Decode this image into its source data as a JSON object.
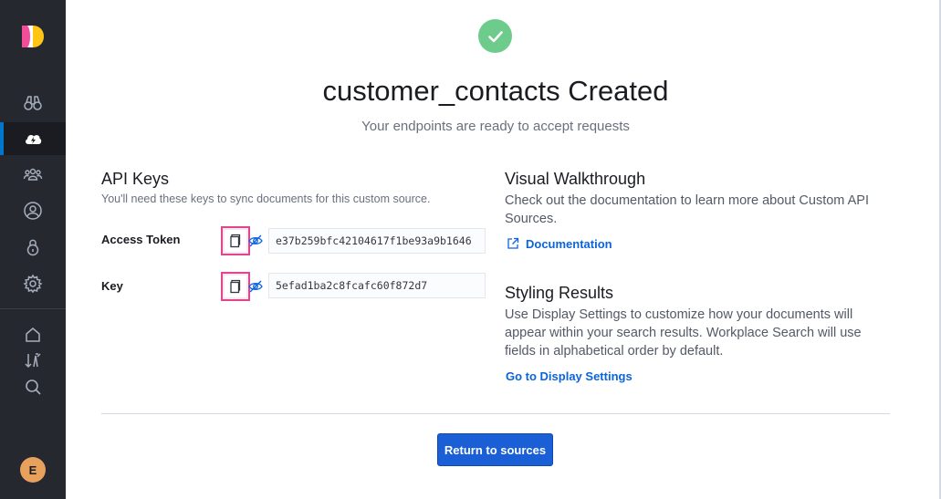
{
  "header": {
    "title": "customer_contacts Created",
    "subtitle": "Your endpoints are ready to accept requests"
  },
  "api_keys": {
    "heading": "API Keys",
    "description": "You'll need these keys to sync documents for this custom source.",
    "access_token_label": "Access Token",
    "access_token_value": "e37b259bfc42104617f1be93a9b1646",
    "key_label": "Key",
    "key_value": "5efad1ba2c8fcafc60f872d7"
  },
  "walkthrough": {
    "heading": "Visual Walkthrough",
    "text": "Check out the documentation to learn more about Custom API Sources.",
    "link": "Documentation"
  },
  "styling": {
    "heading": "Styling Results",
    "text": "Use Display Settings to customize how your documents will appear within your search results. Workplace Search will use fields in alphabetical order by default.",
    "link": "Go to Display Settings"
  },
  "footer": {
    "return_button": "Return to sources"
  },
  "user": {
    "avatar_initial": "E",
    "avatar_color": "#e7a15c"
  },
  "colors": {
    "sidebar_bg": "#25282f",
    "success": "#6dcc8b",
    "link": "#0b64dd",
    "primary_button": "#1a5fd6",
    "highlight": "#e0468d"
  },
  "sidebar": {
    "items": [
      {
        "icon": "binoculars-icon"
      },
      {
        "icon": "cloud-lightning-icon",
        "active": true
      },
      {
        "icon": "users-group-icon"
      },
      {
        "icon": "user-circle-icon"
      },
      {
        "icon": "lock-icon"
      },
      {
        "icon": "gear-icon"
      },
      {
        "icon": "home-icon"
      },
      {
        "icon": "sort-arrows-icon"
      },
      {
        "icon": "search-icon"
      }
    ]
  }
}
